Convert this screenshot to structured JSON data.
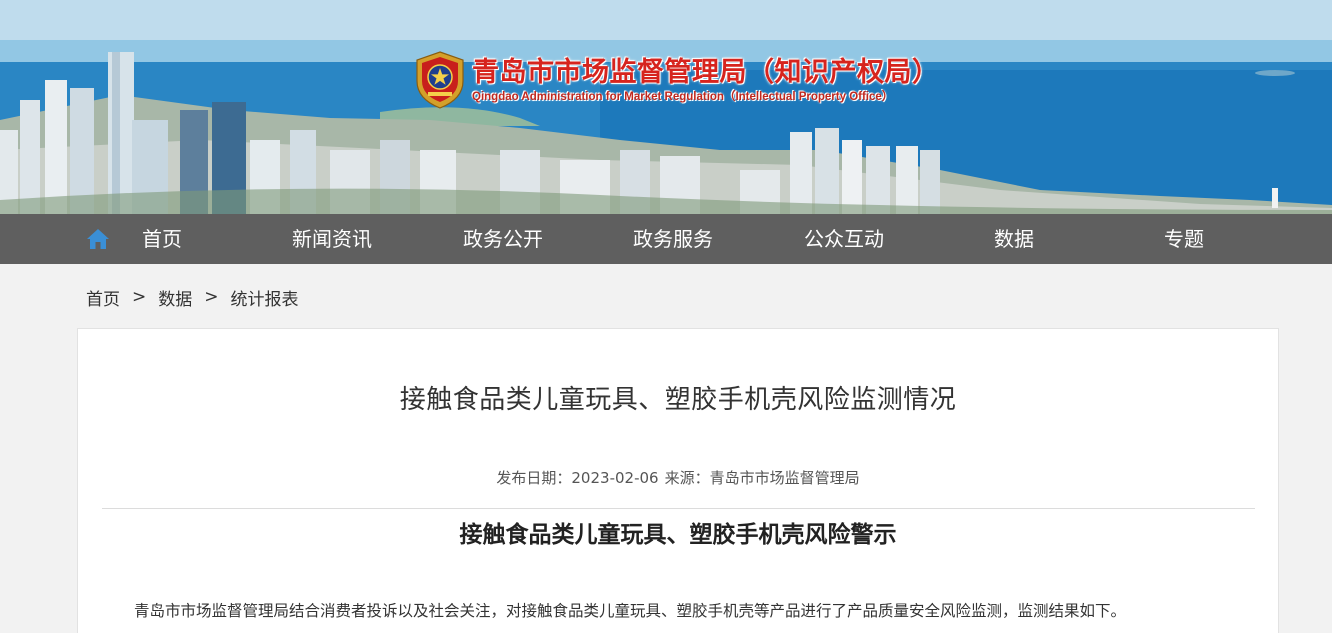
{
  "header": {
    "org_name_cn": "青岛市市场监督管理局（知识产权局）",
    "org_name_en": "Qingdao Administration for Market Regulation（Intellectual Property Office）"
  },
  "nav": {
    "items": [
      {
        "label": "首页"
      },
      {
        "label": "新闻资讯"
      },
      {
        "label": "政务公开"
      },
      {
        "label": "政务服务"
      },
      {
        "label": "公众互动"
      },
      {
        "label": "数据"
      },
      {
        "label": "专题"
      }
    ],
    "home_icon": "home-icon"
  },
  "breadcrumb": {
    "items": [
      "首页",
      "数据",
      "统计报表"
    ],
    "separator": ">"
  },
  "article": {
    "title": "接触食品类儿童玩具、塑胶手机壳风险监测情况",
    "date_label": "发布日期：",
    "date": "2023-02-06",
    "source_label": "来源：",
    "source": "青岛市市场监督管理局",
    "subtitle": "接触食品类儿童玩具、塑胶手机壳风险警示",
    "paragraph": "青岛市市场监督管理局结合消费者投诉以及社会关注，对接触食品类儿童玩具、塑胶手机壳等产品进行了产品质量安全风险监测，监测结果如下。"
  },
  "colors": {
    "nav_bg": "#5f5f5f",
    "logo_red": "#d6241e",
    "home_icon": "#3a8fd6",
    "page_bg": "#f2f2f2"
  }
}
